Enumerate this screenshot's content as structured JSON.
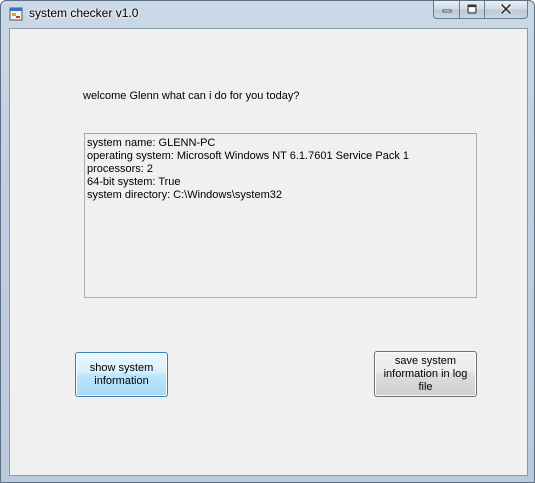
{
  "window": {
    "title": "system checker v1.0",
    "icon": "app-window-icon"
  },
  "caption": {
    "minimize_icon": "minimize-icon",
    "maximize_icon": "maximize-icon",
    "close_icon": "close-icon"
  },
  "main": {
    "welcome_text": "welcome Glenn what can i do for you today?",
    "info_lines": [
      "system name: GLENN-PC",
      "operating system: Microsoft Windows NT 6.1.7601 Service Pack 1",
      "processors: 2",
      "64-bit system: True",
      "system directory: C:\\Windows\\system32"
    ],
    "show_button_label": "show system information",
    "save_button_label": "save system information in log file"
  },
  "colors": {
    "client_background": "#f0f0f0",
    "focused_button_border": "#3c7fb1",
    "button_border": "#707070",
    "close_glyph": "#2b2b2b"
  }
}
